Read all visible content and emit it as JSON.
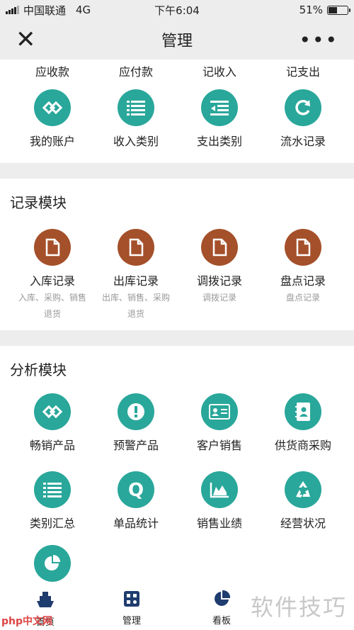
{
  "status": {
    "carrier": "中国联通",
    "network": "4G",
    "time": "下午6:04",
    "battery": "51%",
    "battery_level": 0.51
  },
  "nav": {
    "title": "管理",
    "close": "✕",
    "more": "•••"
  },
  "top_row": [
    "应收款",
    "应付款",
    "记收入",
    "记支出"
  ],
  "finance": [
    {
      "label": "我的账户",
      "icon": "link-icon"
    },
    {
      "label": "收入类别",
      "icon": "list-icon"
    },
    {
      "label": "支出类别",
      "icon": "indent-list-icon"
    },
    {
      "label": "流水记录",
      "icon": "refresh-icon"
    }
  ],
  "records": {
    "title": "记录模块",
    "items": [
      {
        "label": "入库记录",
        "sub1": "入库、采购、销售",
        "sub2": "退货",
        "icon": "document-icon"
      },
      {
        "label": "出库记录",
        "sub1": "出库、销售、采购",
        "sub2": "退货",
        "icon": "document-icon"
      },
      {
        "label": "调拨记录",
        "sub1": "调拨记录",
        "sub2": "",
        "icon": "document-icon"
      },
      {
        "label": "盘点记录",
        "sub1": "盘点记录",
        "sub2": "",
        "icon": "document-icon"
      }
    ]
  },
  "analysis": {
    "title": "分析模块",
    "row1": [
      {
        "label": "畅销产品",
        "icon": "link-icon"
      },
      {
        "label": "预警产品",
        "icon": "alert-icon"
      },
      {
        "label": "客户销售",
        "icon": "id-card-icon"
      },
      {
        "label": "供货商采购",
        "icon": "contacts-book-icon"
      }
    ],
    "row2": [
      {
        "label": "类别汇总",
        "icon": "list-icon"
      },
      {
        "label": "单品统计",
        "icon": "q-icon"
      },
      {
        "label": "销售业绩",
        "icon": "area-chart-icon"
      },
      {
        "label": "经营状况",
        "icon": "recycle-icon"
      }
    ],
    "row3": [
      {
        "label": "",
        "icon": "pie-chart-icon"
      }
    ]
  },
  "tabbar": [
    {
      "label": "首页",
      "icon": "ship-icon"
    },
    {
      "label": "管理",
      "icon": "grid-app-icon"
    },
    {
      "label": "看板",
      "icon": "pie-chart-icon"
    }
  ],
  "watermark": {
    "text": "软件技巧",
    "site": "php中文网"
  },
  "colors": {
    "teal": "#29a79a",
    "brown": "#a4502a",
    "tab_active": "#1f3c6e"
  }
}
